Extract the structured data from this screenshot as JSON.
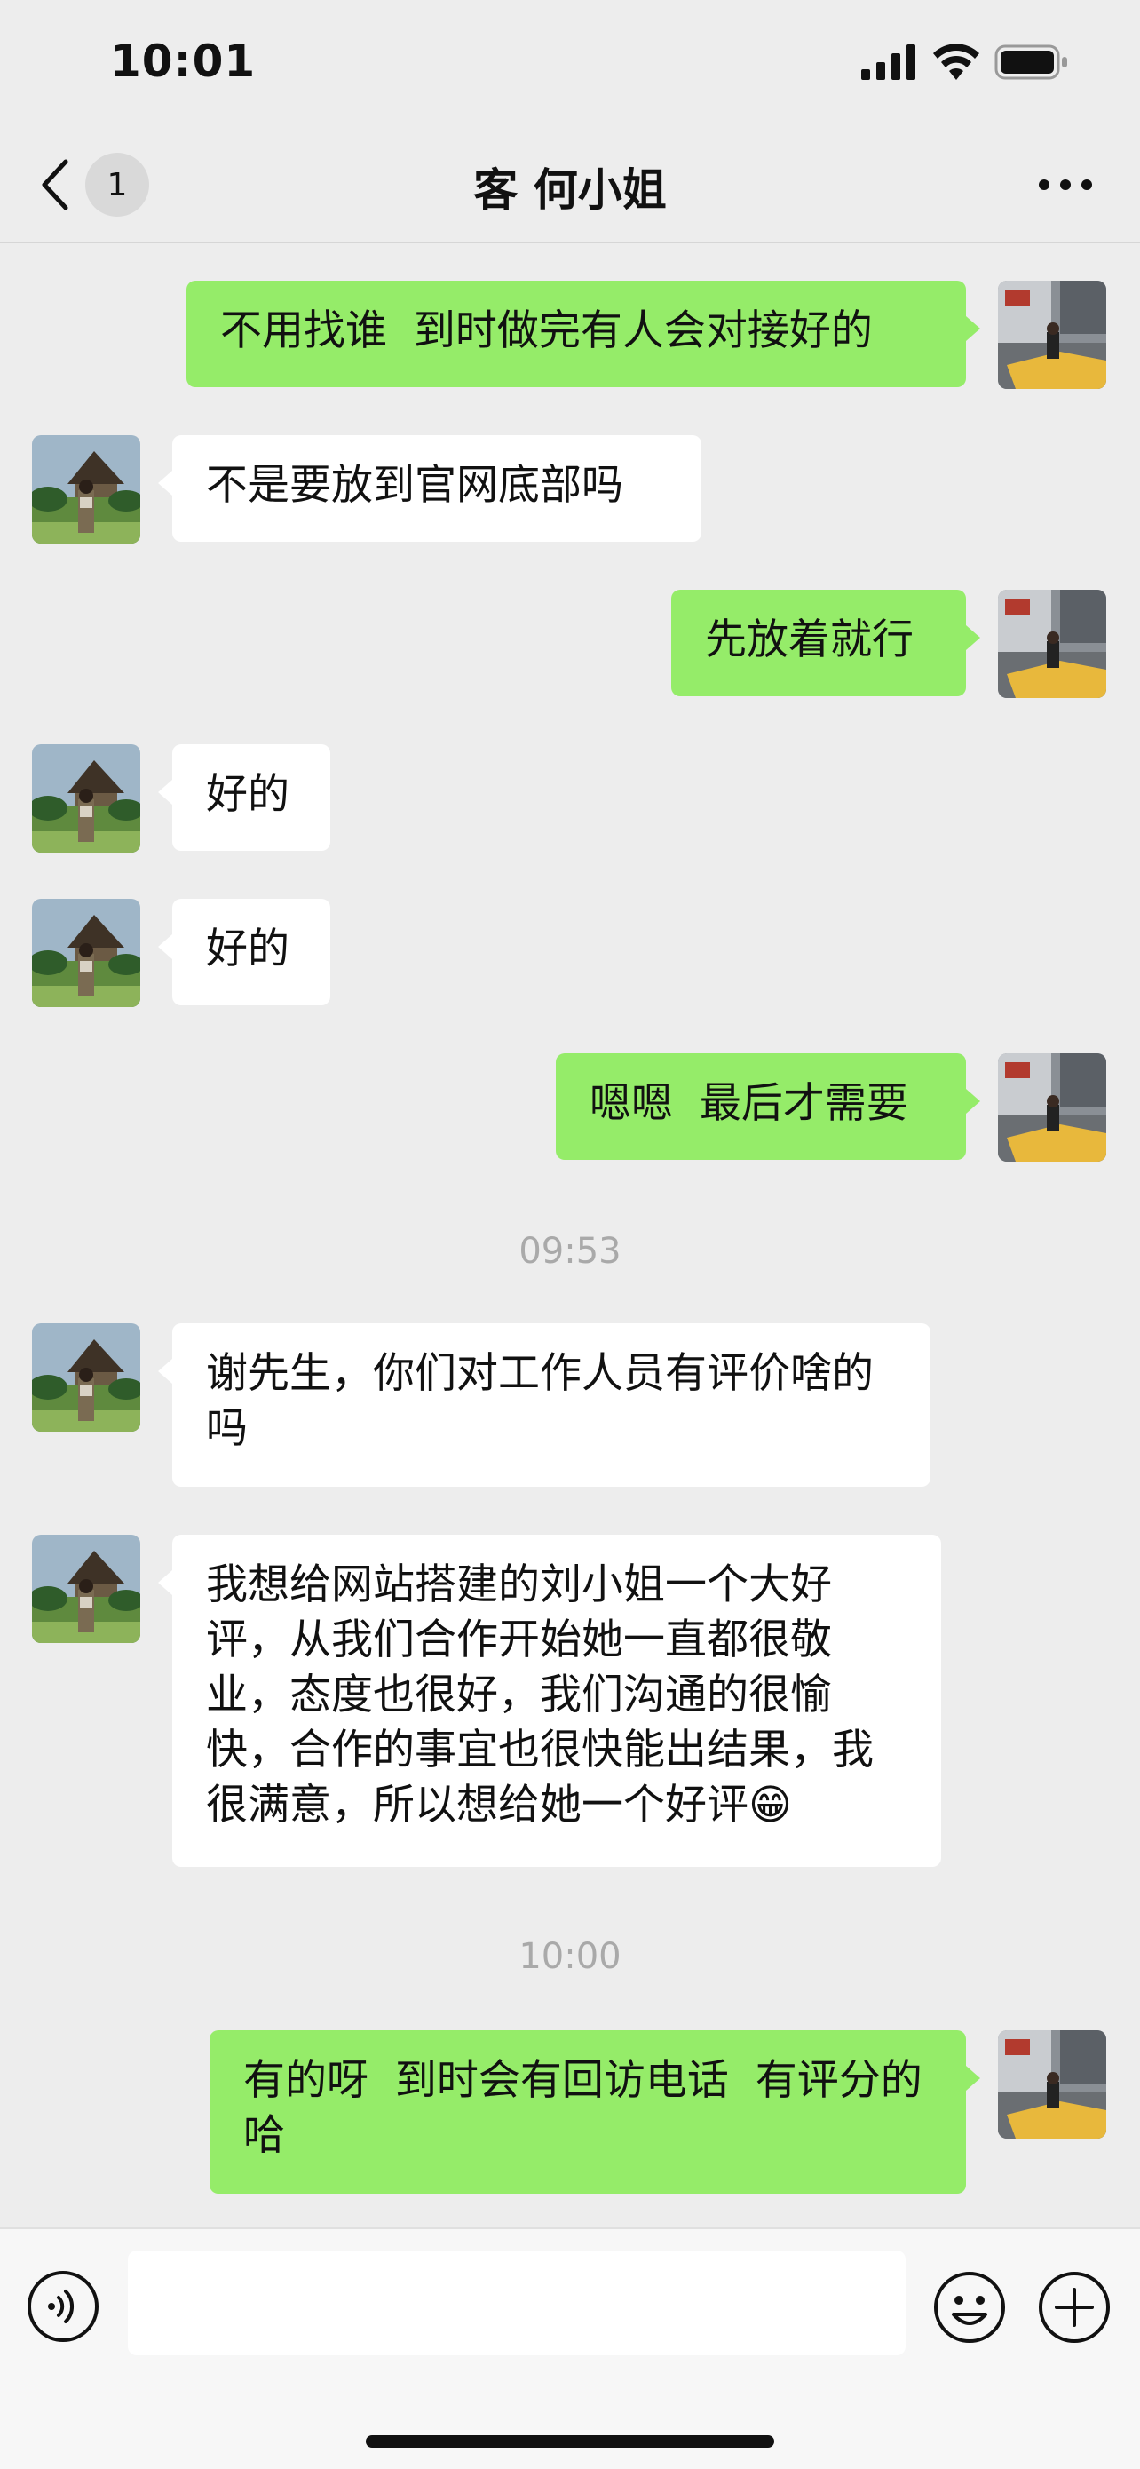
{
  "status": {
    "time": "10:01"
  },
  "header": {
    "unread_count": "1",
    "title": "客 何小姐"
  },
  "messages": [
    {
      "side": "out",
      "text": "不用找谁  到时做完有人会对接好的"
    },
    {
      "side": "in",
      "text": "不是要放到官网底部吗"
    },
    {
      "side": "out",
      "text": "先放着就行"
    },
    {
      "side": "in",
      "text": "好的"
    },
    {
      "side": "in",
      "text": "好的"
    },
    {
      "side": "out",
      "text": "嗯嗯  最后才需要"
    },
    {
      "side": "in",
      "text": "谢先生，你们对工作人员有评价啥的吗"
    },
    {
      "side": "in",
      "text": "我想给网站搭建的刘小姐一个大好评，从我们合作开始她一直都很敬业，态度也很好，我们沟通的很愉快，合作的事宜也很快能出结果，我很满意，所以想给她一个好评😁"
    },
    {
      "side": "out",
      "text": "有的呀  到时会有回访电话  有评分的哈"
    }
  ],
  "timestamps": [
    "09:53",
    "10:00"
  ],
  "input": {
    "value": ""
  },
  "colors": {
    "outgoing_bubble": "#95ec69",
    "incoming_bubble": "#ffffff",
    "background": "#ededed"
  },
  "icons": [
    "back-chevron-icon",
    "more-icon",
    "voice-icon",
    "emoji-icon",
    "plus-icon"
  ]
}
